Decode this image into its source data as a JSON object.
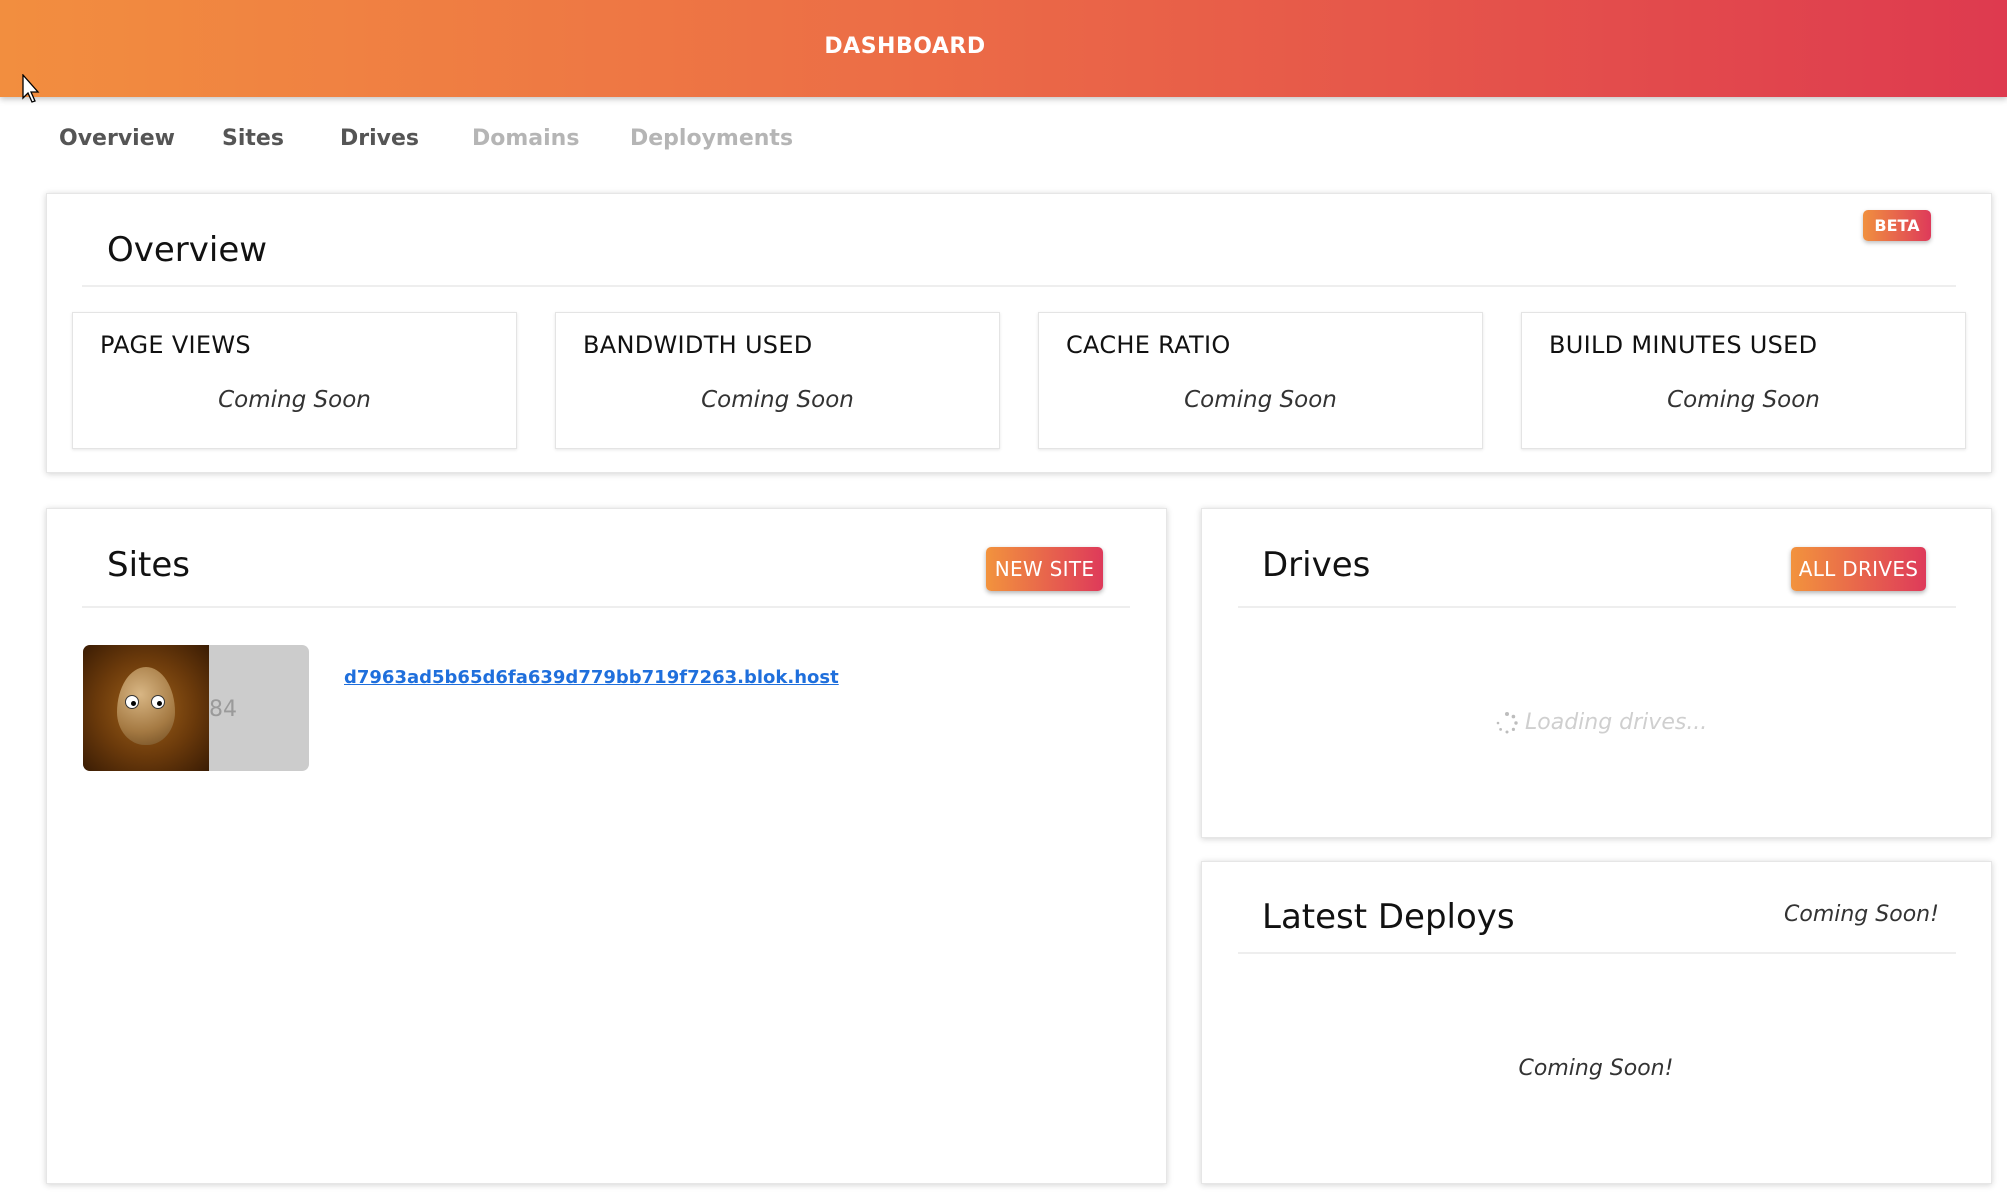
{
  "header": {
    "title": "DASHBOARD"
  },
  "nav": {
    "items": [
      {
        "label": "Overview",
        "state": "active"
      },
      {
        "label": "Sites",
        "state": "active"
      },
      {
        "label": "Drives",
        "state": "active"
      },
      {
        "label": "Domains",
        "state": "disabled"
      },
      {
        "label": "Deployments",
        "state": "disabled"
      }
    ]
  },
  "overview": {
    "title": "Overview",
    "badge": "BETA",
    "stats": [
      {
        "label": "PAGE VIEWS",
        "value": "Coming Soon"
      },
      {
        "label": "BANDWIDTH USED",
        "value": "Coming Soon"
      },
      {
        "label": "CACHE RATIO",
        "value": "Coming Soon"
      },
      {
        "label": "BUILD MINUTES USED",
        "value": "Coming Soon"
      }
    ]
  },
  "sites": {
    "title": "Sites",
    "new_button": "NEW SITE",
    "items": [
      {
        "thumb_alt": "84",
        "url": "d7963ad5b65d6fa639d779bb719f7263.blok.host"
      }
    ]
  },
  "drives": {
    "title": "Drives",
    "all_button": "ALL DRIVES",
    "loading_text": "Loading drives..."
  },
  "deploys": {
    "title": "Latest Deploys",
    "status": "Coming Soon!",
    "body": "Coming Soon!"
  },
  "colors": {
    "header_gradient_start": "#f28e3f",
    "header_gradient_end": "#de3a4f",
    "link": "#1f6fdc",
    "nav_active": "#555555",
    "nav_disabled": "#b5b5b5"
  },
  "icons": [
    "mouse-cursor-icon",
    "spinner-icon"
  ]
}
